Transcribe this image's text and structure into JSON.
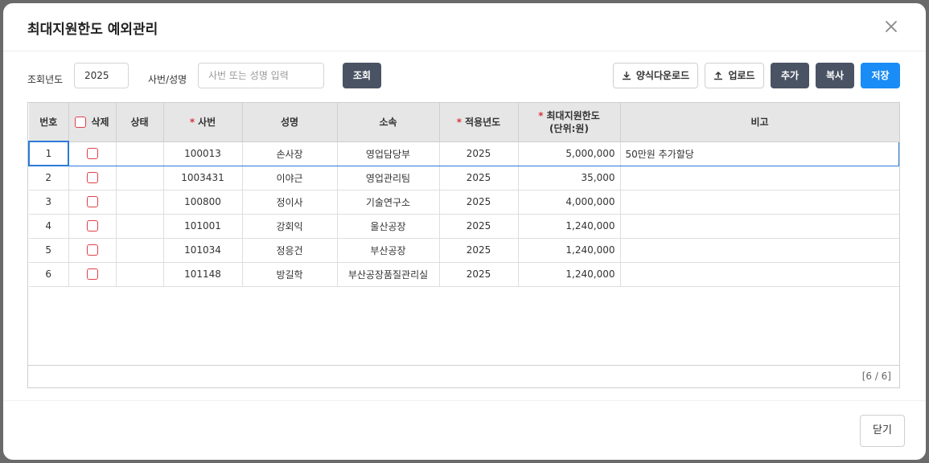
{
  "modal": {
    "title": "최대지원한도 예외관리",
    "close_icon": "close-icon"
  },
  "search": {
    "year_label": "조회년도",
    "year_value": "2025",
    "emp_label": "사번/성명",
    "emp_placeholder": "사번 또는 성명 입력",
    "search_btn": "조회"
  },
  "toolbar": {
    "download_label": "양식다운로드",
    "upload_label": "업로드",
    "add_label": "추가",
    "copy_label": "복사",
    "save_label": "저장",
    "download_icon": "download-icon",
    "upload_icon": "upload-icon"
  },
  "grid": {
    "columns": {
      "no": "번호",
      "delete": "삭제",
      "status": "상태",
      "emp_no": "사번",
      "name": "성명",
      "dept": "소속",
      "apply_year": "적용년도",
      "max_limit_line1": "최대지원한도",
      "max_limit_line2": "(단위:원)",
      "note": "비고"
    },
    "required_mark": "*",
    "rows": [
      {
        "no": "1",
        "status": "",
        "emp_no": "100013",
        "name": "손사장",
        "dept": "영업담당부",
        "year": "2025",
        "limit": "5,000,000",
        "note": "50만원 추가할당"
      },
      {
        "no": "2",
        "status": "",
        "emp_no": "1003431",
        "name": "이야근",
        "dept": "영업관리팀",
        "year": "2025",
        "limit": "35,000",
        "note": ""
      },
      {
        "no": "3",
        "status": "",
        "emp_no": "100800",
        "name": "정이사",
        "dept": "기술연구소",
        "year": "2025",
        "limit": "4,000,000",
        "note": ""
      },
      {
        "no": "4",
        "status": "",
        "emp_no": "101001",
        "name": "강회익",
        "dept": "울산공장",
        "year": "2025",
        "limit": "1,240,000",
        "note": ""
      },
      {
        "no": "5",
        "status": "",
        "emp_no": "101034",
        "name": "정응건",
        "dept": "부산공장",
        "year": "2025",
        "limit": "1,240,000",
        "note": ""
      },
      {
        "no": "6",
        "status": "",
        "emp_no": "101148",
        "name": "방길학",
        "dept": "부산공장품질관리실",
        "year": "2025",
        "limit": "1,240,000",
        "note": ""
      }
    ],
    "paging": "[6 / 6]"
  },
  "footer": {
    "close_label": "닫기"
  },
  "colors": {
    "primary": "#1a8cf5",
    "dark_button": "#4a5363",
    "required": "#d9363e",
    "checkbox": "#e0404a",
    "selection": "#2b7bd8"
  }
}
